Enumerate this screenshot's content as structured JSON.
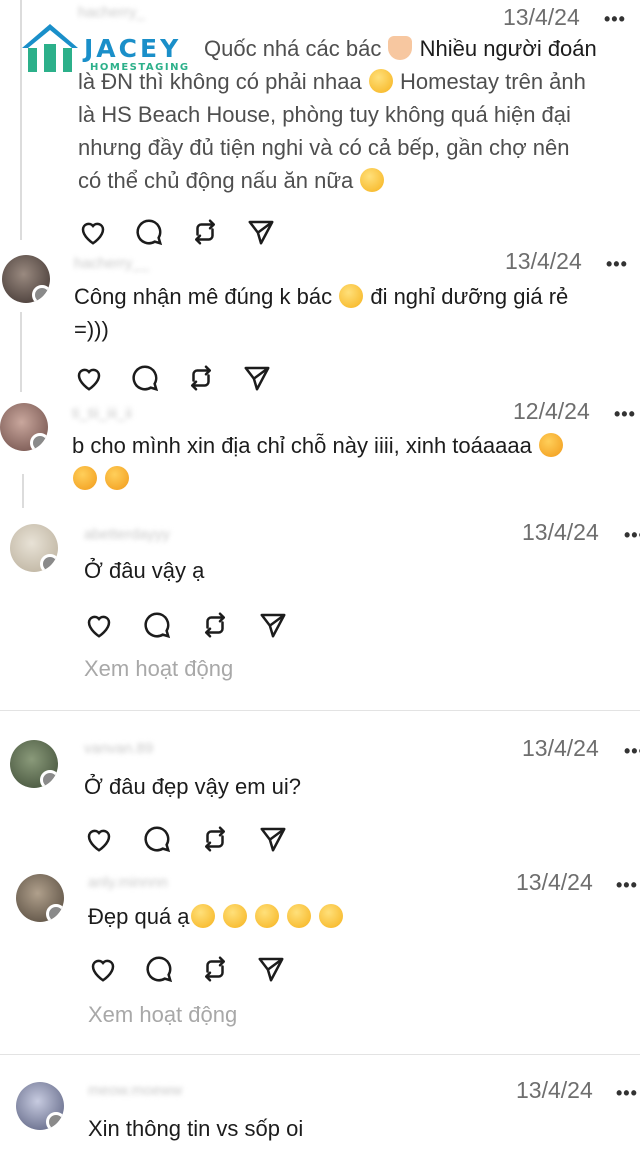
{
  "logo": {
    "brand": "JACEY",
    "sub": "HOMESTAGING",
    "colors": {
      "blue": "#1a8fc9",
      "green": "#2cb08a"
    }
  },
  "comments": [
    {
      "date": "13/4/24",
      "text_parts": [
        "Quốc nhá các bác",
        "Nhiều người đoán là ĐN thì không có phải nhaa",
        "Homestay trên ảnh là HS Beach House, phòng tuy không quá hiện đại nhưng đầy đủ tiện nghi và có cả bếp, gần chợ nên có thể chủ động nấu ăn nữa"
      ],
      "lines": [
        "Quốc nhá các bác",
        "Nhiều người đoán",
        "là ĐN thì không có phải nhaa",
        "Homestay trên ảnh",
        "là HS Beach House, phòng tuy không quá hiện đại",
        "nhưng đầy đủ tiện nghi và có cả bếp, gần chợ nên",
        "có thể chủ động nấu ăn nữa"
      ]
    },
    {
      "date": "13/4/24",
      "lines": [
        "Công nhận mê đúng k bác",
        "đi nghỉ dưỡng giá rẻ",
        "=)))"
      ]
    },
    {
      "date": "12/4/24",
      "lines": [
        "b cho mình xin địa chỉ chỗ này iiii, xinh toáaaaa"
      ]
    },
    {
      "date": "13/4/24",
      "lines": [
        "Ở đâu vậy ạ"
      ],
      "view_activity": "Xem hoạt động"
    },
    {
      "date": "13/4/24",
      "lines": [
        "Ở đâu đẹp vậy em ui?"
      ]
    },
    {
      "date": "13/4/24",
      "lines": [
        "Đẹp quá ạ"
      ],
      "view_activity": "Xem hoạt động"
    },
    {
      "date": "13/4/24",
      "lines": [
        "Xin thông tin vs sốp oi"
      ]
    }
  ],
  "icons": {
    "like": "heart-icon",
    "reply": "comment-icon",
    "repost": "repost-icon",
    "share": "send-icon",
    "more": "more-icon"
  },
  "more_label": "•••"
}
